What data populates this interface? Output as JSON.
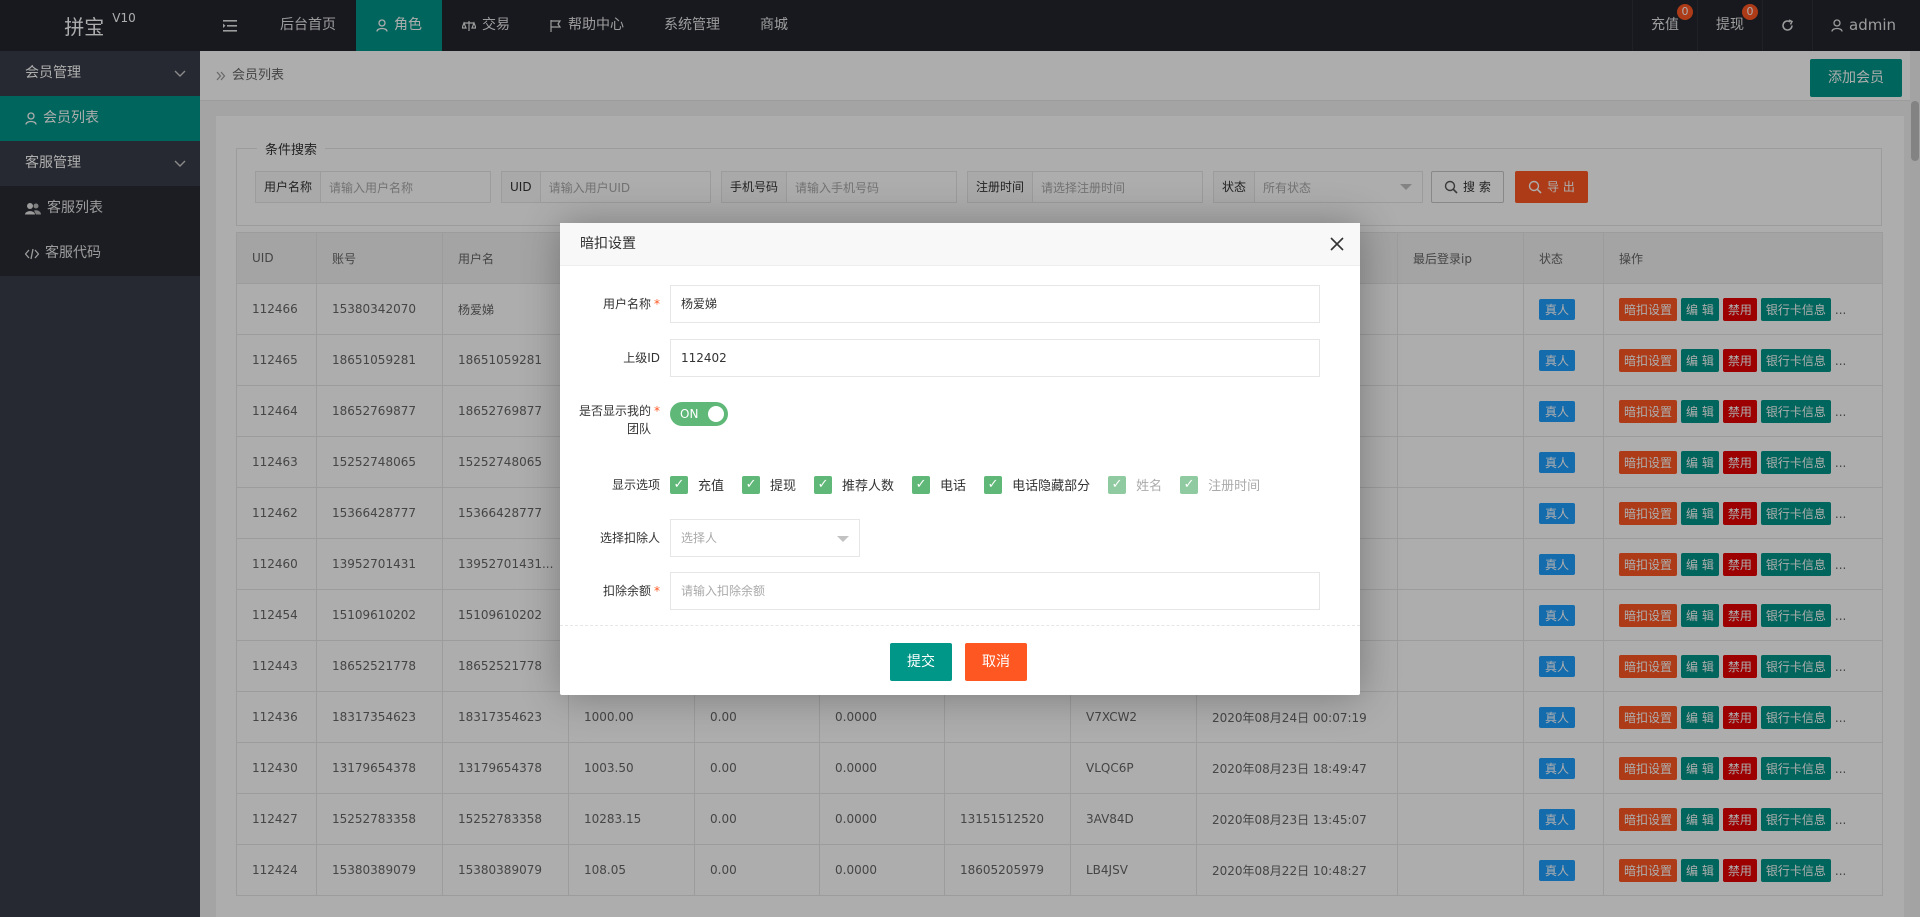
{
  "header": {
    "logo_name": "拼宝",
    "logo_version": "V10",
    "nav": [
      "后台首页",
      "角色",
      "交易",
      "帮助中心",
      "系统管理",
      "商城"
    ],
    "right": {
      "recharge_label": "充值",
      "recharge_badge": "0",
      "withdraw_label": "提现",
      "withdraw_badge": "0",
      "user_label": "admin"
    }
  },
  "sidebar": {
    "groups": [
      {
        "label": "会员管理",
        "items": [
          "会员列表"
        ]
      },
      {
        "label": "客服管理",
        "items": [
          "客服列表",
          "客服代码"
        ]
      }
    ]
  },
  "breadcrumb": "会员列表",
  "add_button": "添加会员",
  "search": {
    "legend": "条件搜索",
    "fields": [
      {
        "label": "用户名称",
        "placeholder": "请输入用户名称"
      },
      {
        "label": "UID",
        "placeholder": "请输入用户UID"
      },
      {
        "label": "手机号码",
        "placeholder": "请输入手机号码"
      },
      {
        "label": "注册时间",
        "placeholder": "请选择注册时间"
      },
      {
        "label": "状态",
        "placeholder": "所有状态"
      }
    ],
    "search_button": "搜 索",
    "export_button": "导 出"
  },
  "table": {
    "columns": [
      "UID",
      "账号",
      "用户名",
      "",
      "",
      "",
      "",
      "",
      "",
      "最后登录ip",
      "状态",
      "操作"
    ],
    "status_tag": "真人",
    "actions": [
      "暗扣设置",
      "编 辑",
      "禁用",
      "银行卡信息"
    ],
    "more": "...",
    "rows": [
      [
        "112466",
        "15380342070",
        "杨爱娣",
        "",
        "",
        "",
        "",
        "",
        ""
      ],
      [
        "112465",
        "18651059281",
        "18651059281",
        "",
        "",
        "",
        "",
        "",
        ""
      ],
      [
        "112464",
        "18652769877",
        "18652769877",
        "",
        "",
        "",
        "",
        "",
        ""
      ],
      [
        "112463",
        "15252748065",
        "15252748065",
        "",
        "",
        "",
        "",
        "",
        ""
      ],
      [
        "112462",
        "15366428777",
        "15366428777",
        "",
        "",
        "",
        "",
        "",
        ""
      ],
      [
        "112460",
        "13952701431",
        "13952701431...",
        "",
        "",
        "",
        "",
        "",
        ""
      ],
      [
        "112454",
        "15109610202",
        "15109610202",
        "",
        "",
        "",
        "",
        "",
        ""
      ],
      [
        "112443",
        "18652521778",
        "18652521778",
        "",
        "",
        "",
        "",
        "",
        ""
      ],
      [
        "112436",
        "18317354623",
        "18317354623",
        "1000.00",
        "0.00",
        "0.0000",
        "",
        "V7XCW2",
        "2020年08月24日 00:07:19"
      ],
      [
        "112430",
        "13179654378",
        "13179654378",
        "1003.50",
        "0.00",
        "0.0000",
        "",
        "VLQC6P",
        "2020年08月23日 18:49:47"
      ],
      [
        "112427",
        "15252783358",
        "15252783358",
        "10283.15",
        "0.00",
        "0.0000",
        "13151512520",
        "3AV84D",
        "2020年08月23日 13:45:07"
      ],
      [
        "112424",
        "15380389079",
        "15380389079",
        "108.05",
        "0.00",
        "0.0000",
        "18605205979",
        "LB4JSV",
        "2020年08月22日 10:48:27"
      ]
    ]
  },
  "modal": {
    "title": "暗扣设置",
    "username_label": "用户名称",
    "username_value": "杨爱娣",
    "parent_label": "上级ID",
    "parent_value": "112402",
    "team_label": "是否显示我的团队",
    "team_switch": "ON",
    "options_label": "显示选项",
    "options": [
      {
        "label": "充值",
        "checked": true,
        "disabled": false
      },
      {
        "label": "提现",
        "checked": true,
        "disabled": false
      },
      {
        "label": "推荐人数",
        "checked": true,
        "disabled": false
      },
      {
        "label": "电话",
        "checked": true,
        "disabled": false
      },
      {
        "label": "电话隐藏部分",
        "checked": true,
        "disabled": false
      },
      {
        "label": "姓名",
        "checked": true,
        "disabled": true
      },
      {
        "label": "注册时间",
        "checked": true,
        "disabled": true
      }
    ],
    "deduct_person_label": "选择扣除人",
    "deduct_person_placeholder": "选择人",
    "deduct_amount_label": "扣除余额",
    "deduct_amount_placeholder": "请输入扣除余额",
    "submit": "提交",
    "cancel": "取消"
  },
  "colors": {
    "accent": "#009688",
    "header_bg": "#23262e",
    "sidebar_bg": "#393d49",
    "orange": "#ff5722",
    "blue": "#1e9fff",
    "red": "#e60000",
    "switch_green": "#5fb878"
  }
}
